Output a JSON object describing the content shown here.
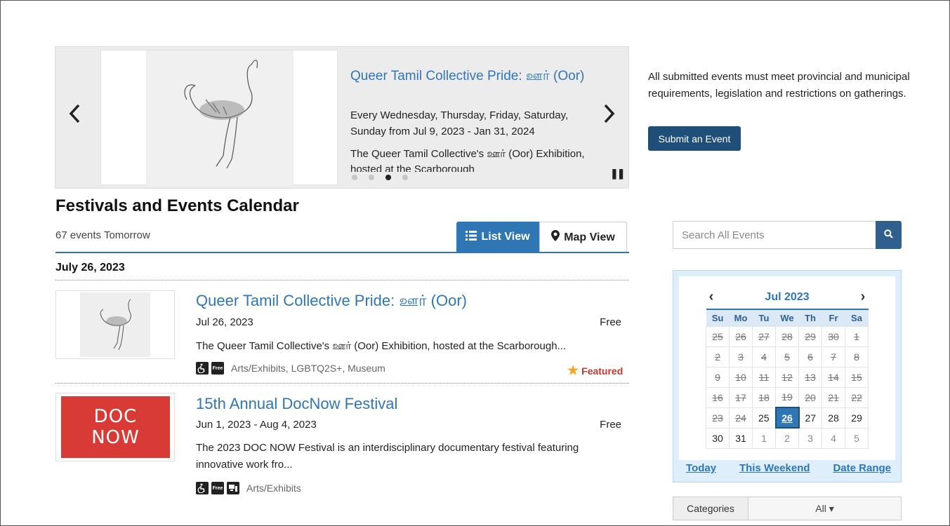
{
  "carousel": {
    "prev_icon": "chevron-left",
    "next_icon": "chevron-right",
    "title": "Queer Tamil Collective Pride: ஊர் (Oor)",
    "dates": "Every Wednesday, Thursday, Friday, Saturday, Sunday from Jul 9, 2023 - Jan 31, 2024",
    "description": "The Queer Tamil Collective's ஊர் (Oor) Exhibition, hosted at the Scarborough",
    "slide_count": 4,
    "active_slide": 3,
    "pause_label": "❚❚"
  },
  "notice": {
    "text": "All submitted events must meet provincial and municipal requirements, legislation and restrictions on gatherings.",
    "submit_label": "Submit an Event"
  },
  "listing": {
    "title": "Festivals and Events Calendar",
    "count": "67 events Tomorrow",
    "list_view_label": "List View",
    "map_view_label": "Map View",
    "date_heading": "July 26, 2023"
  },
  "events": [
    {
      "title": "Queer Tamil Collective Pride: ஊர் (Oor)",
      "date": "Jul 26, 2023",
      "price": "Free",
      "description": "The Queer Tamil Collective's ஊர் (Oor) Exhibition, hosted at the Scarborough...",
      "tags": "Arts/Exhibits, LGBTQ2S+, Museum",
      "featured": "Featured"
    },
    {
      "title": "15th Annual DocNow Festival",
      "date": "Jun 1, 2023 - Aug 4, 2023",
      "price": "Free",
      "description": "The 2023 DOC NOW Festival is an interdisciplinary documentary festival featuring innovative work fro...",
      "tags": "Arts/Exhibits",
      "logo_line1": "DOC",
      "logo_line2": "NOW"
    }
  ],
  "badges": {
    "free": "Free"
  },
  "search": {
    "placeholder": "Search All Events"
  },
  "calendar": {
    "month": "Jul 2023",
    "weekdays": [
      "Su",
      "Mo",
      "Tu",
      "We",
      "Th",
      "Fr",
      "Sa"
    ],
    "weeks": [
      [
        "25",
        "26",
        "27",
        "28",
        "29",
        "30",
        "1"
      ],
      [
        "2",
        "3",
        "4",
        "5",
        "6",
        "7",
        "8"
      ],
      [
        "9",
        "10",
        "11",
        "12",
        "13",
        "14",
        "15"
      ],
      [
        "16",
        "17",
        "18",
        "19",
        "20",
        "21",
        "22"
      ],
      [
        "23",
        "24",
        "25",
        "26",
        "27",
        "28",
        "29"
      ],
      [
        "30",
        "31",
        "1",
        "2",
        "3",
        "4",
        "5"
      ]
    ],
    "selected": "26",
    "links": [
      "Today",
      "This Weekend",
      "Date Range"
    ]
  },
  "categories": {
    "label": "Categories",
    "value": "All ▾"
  },
  "colors": {
    "accent": "#2f76b4",
    "dark_button": "#1f4e79",
    "featured": "#c0392b",
    "star": "#f5a623",
    "docnow": "#d83a35"
  }
}
